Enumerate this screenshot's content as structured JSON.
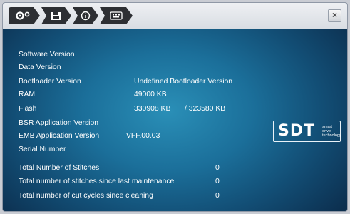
{
  "window": {
    "close_label": "×",
    "breadcrumb_icons": [
      "settings-icon",
      "save-icon",
      "info-icon",
      "keyboard-icon"
    ]
  },
  "info": {
    "software_version": {
      "label": "Software Version",
      "value": ""
    },
    "data_version": {
      "label": "Data Version",
      "value": ""
    },
    "bootloader_version": {
      "label": "Bootloader Version",
      "value": "Undefined Bootloader Version"
    },
    "ram": {
      "label": "RAM",
      "value": "49000 KB"
    },
    "flash": {
      "label": "Flash",
      "value": "330908 KB",
      "value2": "/ 323580 KB"
    },
    "bsr_app_version": {
      "label": "BSR Application Version",
      "value": ""
    },
    "emb_app_version": {
      "label": "EMB Application Version",
      "value": "VFF.00.03"
    },
    "serial_number": {
      "label": "Serial Number",
      "value": ""
    },
    "total_stitches": {
      "label": "Total Number of Stitches",
      "value": "0"
    },
    "stitches_since_maintenance": {
      "label": "Total number of stitches since last maintenance",
      "value": "0"
    },
    "cut_cycles_since_cleaning": {
      "label": "Total number of cut cycles since cleaning",
      "value": "0"
    }
  },
  "logo": {
    "mark": "SDT",
    "tagline": [
      "smart",
      "drive",
      "technology"
    ]
  },
  "colors": {
    "background_center": "#2a8fb7",
    "background_edge": "#0c2f4f",
    "text": "#ffffff",
    "crumb": "#2d2f33"
  }
}
